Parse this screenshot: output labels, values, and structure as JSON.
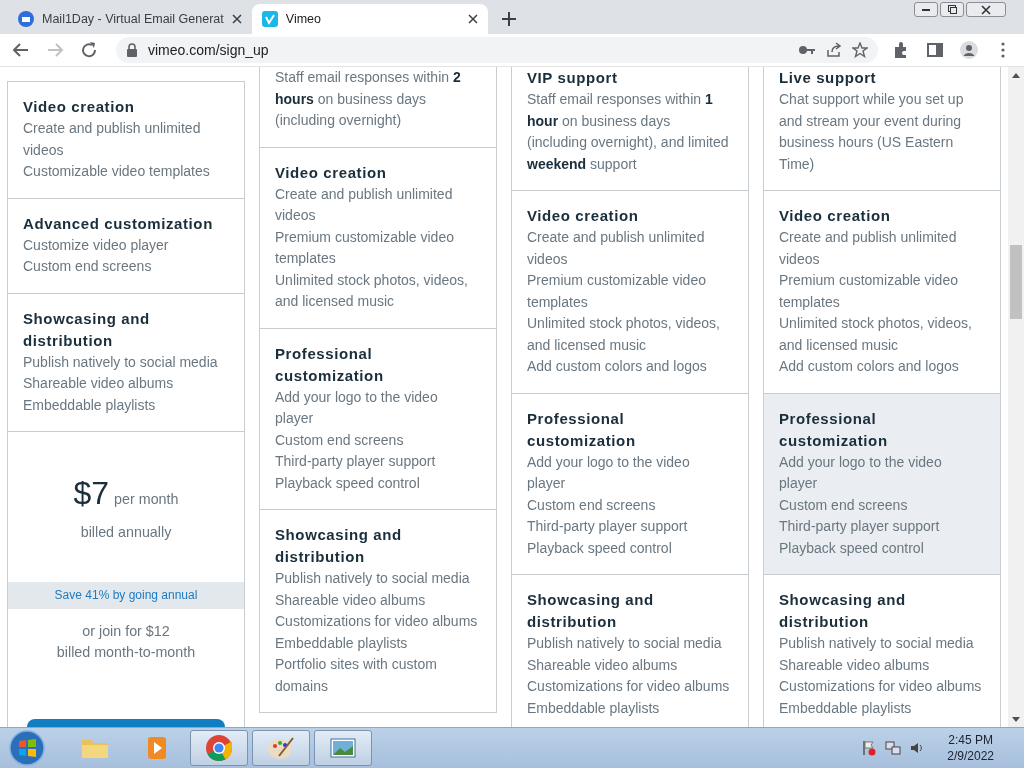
{
  "browser": {
    "tabs": [
      {
        "title": "Mail1Day - Virtual Email Generat",
        "selected": false
      },
      {
        "title": "Vimeo",
        "selected": true
      }
    ],
    "url": "vimeo.com/sign_up"
  },
  "columns": [
    {
      "top_rule": true,
      "sections": [
        {
          "kind": "features",
          "highlighted": false,
          "heading": "Video creation",
          "items": [
            "Create and publish unlimited videos",
            "Customizable video templates"
          ]
        },
        {
          "kind": "features",
          "highlighted": false,
          "heading": "Advanced customization",
          "items": [
            "Customize video player",
            "Custom end screens"
          ]
        },
        {
          "kind": "features",
          "highlighted": false,
          "heading": "Showcasing and distribution",
          "items": [
            "Publish natively to social media",
            "Shareable video albums",
            "Embeddable playlists"
          ]
        },
        {
          "kind": "pricing",
          "highlighted": false,
          "price": "$7",
          "period": "per month",
          "billing": "billed annually",
          "save": "Save 41% by going annual",
          "alt_price": "or join for $12",
          "alt_billing": "billed month-to-month"
        }
      ]
    },
    {
      "top_rule": false,
      "sections": [
        {
          "kind": "support",
          "highlighted": false,
          "text": "Staff email responses within **2 hours** on business days (including overnight)"
        },
        {
          "kind": "features",
          "highlighted": false,
          "heading": "Video creation",
          "items": [
            "Create and publish unlimited videos",
            "Premium customizable video templates",
            "Unlimited stock photos, videos, and licensed music"
          ]
        },
        {
          "kind": "features",
          "highlighted": false,
          "heading": "Professional customization",
          "items": [
            "Add your logo to the video player",
            "Custom end screens",
            "Third-party player support",
            "Playback speed control"
          ]
        },
        {
          "kind": "features",
          "highlighted": false,
          "heading": "Showcasing and distribution",
          "items": [
            "Publish natively to social media",
            "Shareable video albums",
            "Customizations for video albums",
            "Embeddable playlists",
            "Portfolio sites with custom domains"
          ]
        }
      ]
    },
    {
      "top_rule": false,
      "sections": [
        {
          "kind": "support",
          "highlighted": false,
          "heading": "VIP support",
          "text": "Staff email responses within **1 hour** on business days (including overnight), and limited **weekend** support"
        },
        {
          "kind": "features",
          "highlighted": false,
          "heading": "Video creation",
          "items": [
            "Create and publish unlimited videos",
            "Premium customizable video templates",
            "Unlimited stock photos, videos, and licensed music",
            "Add custom colors and logos"
          ]
        },
        {
          "kind": "features",
          "highlighted": false,
          "heading": "Professional customization",
          "items": [
            "Add your logo to the video player",
            "Custom end screens",
            "Third-party player support",
            "Playback speed control"
          ]
        },
        {
          "kind": "features",
          "highlighted": false,
          "heading": "Showcasing and distribution",
          "items": [
            "Publish natively to social media",
            "Shareable video albums",
            "Customizations for video albums",
            "Embeddable playlists"
          ]
        }
      ]
    },
    {
      "top_rule": false,
      "sections": [
        {
          "kind": "support",
          "highlighted": false,
          "heading": "Live support",
          "text": "Chat support while you set up and stream your event during business hours (US Eastern Time)"
        },
        {
          "kind": "features",
          "highlighted": false,
          "heading": "Video creation",
          "items": [
            "Create and publish unlimited videos",
            "Premium customizable video templates",
            "Unlimited stock photos, videos, and licensed music",
            "Add custom colors and logos"
          ]
        },
        {
          "kind": "features",
          "highlighted": true,
          "heading": "Professional customization",
          "items": [
            "Add your logo to the video player",
            "Custom end screens",
            "Third-party player support",
            "Playback speed control"
          ]
        },
        {
          "kind": "features",
          "highlighted": false,
          "heading": "Showcasing and distribution",
          "items": [
            "Publish natively to social media",
            "Shareable video albums",
            "Customizations for video albums",
            "Embeddable playlists"
          ]
        }
      ]
    }
  ],
  "taskbar": {
    "time": "2:45 PM",
    "date": "2/9/2022"
  }
}
